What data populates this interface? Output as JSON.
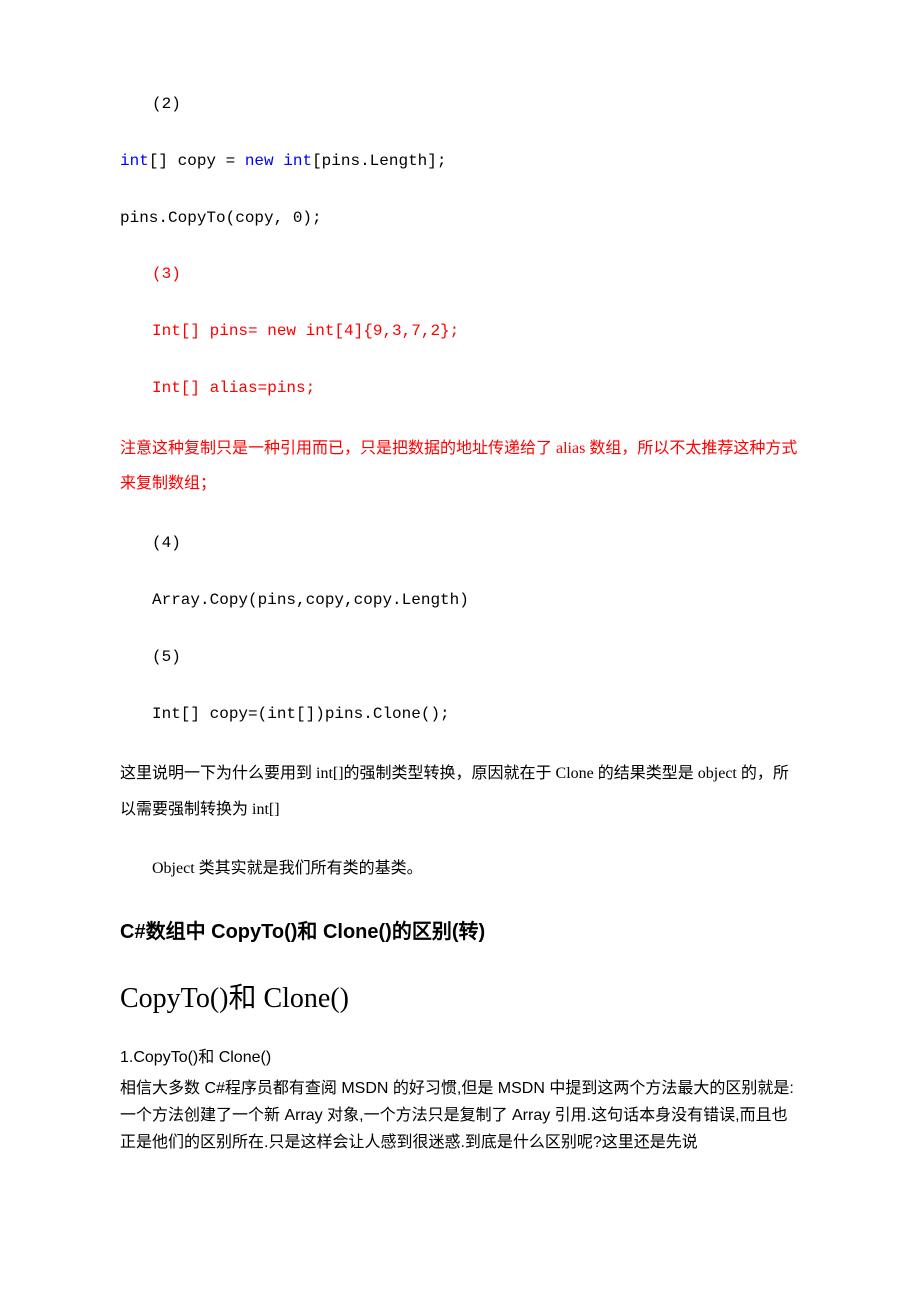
{
  "lines": {
    "l2_num": "(2)",
    "l2a_kw1": "int",
    "l2a_txt1": "[] copy = ",
    "l2a_kw2": "new",
    "l2a_txt2": " ",
    "l2a_kw3": "int",
    "l2a_txt3": "[pins.Length];",
    "l2b": " pins.CopyTo(copy, 0);",
    "l3_num": "(3)",
    "l3a": "Int[] pins= new int[4]{9,3,7,2};",
    "l3b": "Int[] alias=pins;",
    "l3c": "     注意这种复制只是一种引用而已，只是把数据的地址传递给了 alias 数组，所以不太推荐这种方式来复制数组；",
    "l4_num": "(4)",
    "l4a": "Array.Copy(pins,copy,copy.Length)",
    "l5_num": "(5)",
    "l5a": "Int[] copy=(int[])pins.Clone();",
    "l5b": "     这里说明一下为什么要用到 int[]的强制类型转换，原因就在于 Clone 的结果类型是 object 的，所以需要强制转换为 int[]",
    "l5c": "Object 类其实就是我们所有类的基类。"
  },
  "heading3": "C#数组中 CopyTo()和 Clone()的区别(转)",
  "heading2": "CopyTo()和 Clone()",
  "section": {
    "p1": "1.CopyTo()和 Clone()",
    "p2": "相信大多数 C#程序员都有查阅 MSDN 的好习惯,但是 MSDN 中提到这两个方法最大的区别就是:一个方法创建了一个新 Array 对象,一个方法只是复制了 Array 引用.这句话本身没有错误,而且也正是他们的区别所在.只是这样会让人感到很迷惑.到底是什么区别呢?这里还是先说"
  }
}
